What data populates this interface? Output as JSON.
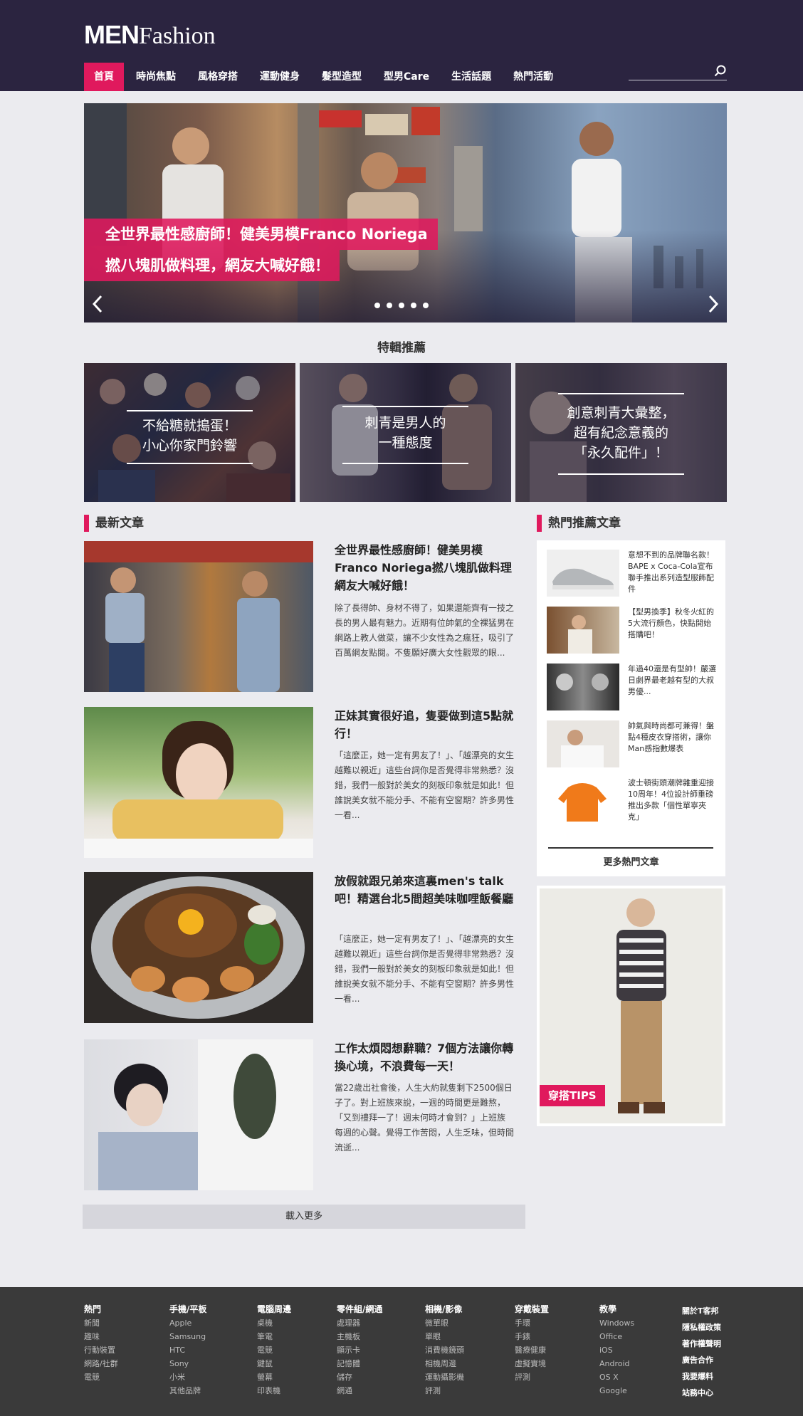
{
  "logo": {
    "men": "MEN",
    "fashion": "Fashion"
  },
  "nav": [
    "首頁",
    "時尚焦點",
    "風格穿搭",
    "運動健身",
    "髮型造型",
    "型男Care",
    "生活話題",
    "熱門活動"
  ],
  "hero": {
    "caption_line1": "全世界最性感廚師！健美男模Franco Noriega",
    "caption_line2": "撚八塊肌做料理，網友大喊好餓！",
    "slide_count": 5
  },
  "featured": {
    "title": "特輯推薦",
    "items": [
      {
        "line1": "不給糖就搗蛋！",
        "line2": "小心你家門鈴響"
      },
      {
        "line1": "刺青是男人的",
        "line2": "一種態度"
      },
      {
        "line1": "創意刺青大彙整，",
        "line2": "超有紀念意義的",
        "line3": "「永久配件」！"
      }
    ]
  },
  "latest": {
    "heading": "最新文章",
    "articles": [
      {
        "title": "全世界最性感廚師！健美男模Franco Noriega撚八塊肌做料理網友大喊好餓！",
        "desc": "除了長得帥、身材不得了，如果還能齊有一技之長的男人最有魅力。近期有位帥氣的全裸猛男在網路上教人做菜，讓不少女性為之瘋狂，吸引了百萬網友點閱。不隻願好廣大女性觀眾的眼..."
      },
      {
        "title": "正妹其實很好追，隻要做到這5點就行！",
        "desc": "「這麼正，她一定有男友了！」、「越漂亮的女生越難以親近」這些台詞你是否覺得非常熟悉？沒錯，我們一般對於美女的刻板印象就是如此！但誰說美女就不能分手、不能有空窗期？許多男性一看..."
      },
      {
        "title": "放假就跟兄弟來這裏men's talk吧！精選台北5間超美味咖哩飯餐廳",
        "desc": "「這麼正，她一定有男友了！」、「越漂亮的女生越難以親近」這些台詞你是否覺得非常熟悉？沒錯，我們一般對於美女的刻板印象就是如此！但誰說美女就不能分手、不能有空窗期？許多男性一看..."
      },
      {
        "title": "工作太煩悶想辭職？7個方法讓你轉換心境，不浪費每一天！",
        "desc": "當22歲出社會後，人生大約就隻剩下2500個日子了。對上班族來說，一週的時間更是難熬，「又到禮拜一了！週末何時才會到？」上班族每週的心聲。覺得工作苦悶，人生乏味，但時間流逝..."
      }
    ],
    "load_more": "載入更多"
  },
  "hot": {
    "heading": "熱門推薦文章",
    "items": [
      "意想不到的品牌聯名款！BAPE x Coca-Cola宣布聯手推出系列造型服飾配件",
      "【型男換季】秋冬火紅的5大流行顏色，快點開始搭購吧！",
      "年過40還是有型帥！嚴選日劇界最老越有型的大叔男優...",
      "帥氣與時尚都可兼得！盤點4種皮衣穿搭術，讓你Man感指數爆表",
      "波士頓街頭潮牌雜重迎接10周年！4位設計師重磅推出多款「個性單寧夾克」"
    ],
    "more": "更多熱門文章"
  },
  "tips": {
    "badge": "穿搭TIPS"
  },
  "footer": {
    "columns": [
      {
        "head": "熱門",
        "links": [
          "新聞",
          "趣味",
          "行動裝置",
          "網路/社群",
          "電競"
        ]
      },
      {
        "head": "手機/平板",
        "links": [
          "Apple",
          "Samsung",
          "HTC",
          "Sony",
          "小米",
          "其他品牌"
        ]
      },
      {
        "head": "電腦周邊",
        "links": [
          "桌機",
          "筆電",
          "電競",
          "鍵鼠",
          "螢幕",
          "印表機"
        ]
      },
      {
        "head": "零件組/網通",
        "links": [
          "處理器",
          "主機板",
          "顯示卡",
          "記憶體",
          "儲存",
          "網通"
        ]
      },
      {
        "head": "相機/影像",
        "links": [
          "微單眼",
          "單眼",
          "消費機鏡頭",
          "相機周邊",
          "運動攝影機",
          "評測"
        ]
      },
      {
        "head": "穿戴裝置",
        "links": [
          "手環",
          "手錶",
          "醫療健康",
          "虛擬實境",
          "評測"
        ]
      },
      {
        "head": "教學",
        "links": [
          "Windows",
          "Office",
          "iOS",
          "Android",
          "OS X",
          "Google"
        ]
      }
    ],
    "right_links": [
      "關於T客邦",
      "隱私權政策",
      "著作權聲明",
      "廣告合作",
      "我要爆料",
      "站務中心"
    ]
  },
  "colors": {
    "header_bg": "#2b2440",
    "accent": "#e0195d",
    "footer_bg": "#3a3a3a",
    "page_bg": "#ebebef"
  }
}
